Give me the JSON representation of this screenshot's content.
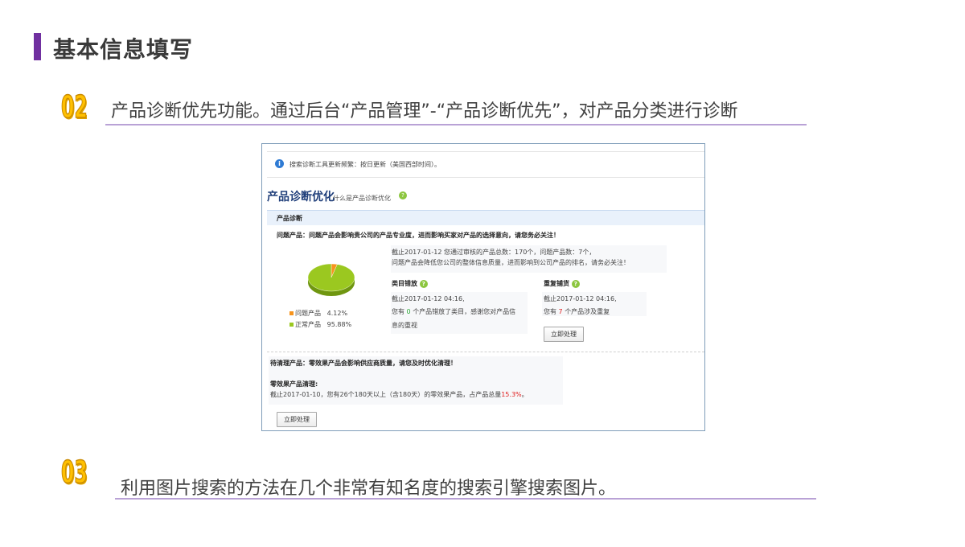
{
  "slide": {
    "title": "基本信息填写",
    "steps": [
      {
        "number": "02",
        "text": "产品诊断优先功能。通过后台“产品管理”-“产品诊断优先”，对产品分类进行诊断"
      },
      {
        "number": "03",
        "text": "利用图片搜索的方法在几个非常有知名度的搜索引擎搜索图片。"
      }
    ]
  },
  "screenshot": {
    "notice": "搜索诊断工具更新频繁：按日更新（美国西部时间）。",
    "section_title": "产品诊断优化",
    "section_link": "什么是产品诊断优化",
    "panel_title": "产品诊断",
    "problem_intro": "问题产品：问题产品会影响贵公司的产品专业度，进而影响买家对产品的选择意向，请您务必关注！",
    "summary_line1": "截止2017-01-12 您通过审核的产品总数：170个，问题产品数：7个，",
    "summary_line2": "问题产品会降低您公司的整体信息质量，进而影响到公司产品的排名，请务必关注！",
    "legend": [
      {
        "label": "问题产品",
        "value": "4.12%",
        "color": "#f7941d"
      },
      {
        "label": "正常产品",
        "value": "95.88%",
        "color": "#9bc820"
      }
    ],
    "misplaced": {
      "title": "类目错放",
      "date": "截止2017-01-12 04:16,",
      "text_prefix": "您有",
      "count": "0",
      "text_suffix": "个产品错放了类目，感谢您对产品信",
      "text_line2": "息的重视"
    },
    "duplicate": {
      "title": "重复铺货",
      "date": "截止2017-01-12 04:16,",
      "text_prefix": "您有",
      "count": "7",
      "text_suffix": "个产品涉及重复",
      "button": "立即处理"
    },
    "pending": {
      "intro": "待清理产品：零效果产品会影响供应商质量，请您及时优化清理！",
      "title": "零效果产品清理:",
      "text": "截止2017-01-10，您有26个180天以上（含180天）的零效果产品，占产品总量",
      "percent": "15.3%",
      "end": "。",
      "button": "立即处理"
    }
  },
  "chart_data": {
    "type": "pie",
    "categories": [
      "问题产品",
      "正常产品"
    ],
    "values": [
      4.12,
      95.88
    ],
    "colors": [
      "#f7941d",
      "#9bc820"
    ]
  }
}
